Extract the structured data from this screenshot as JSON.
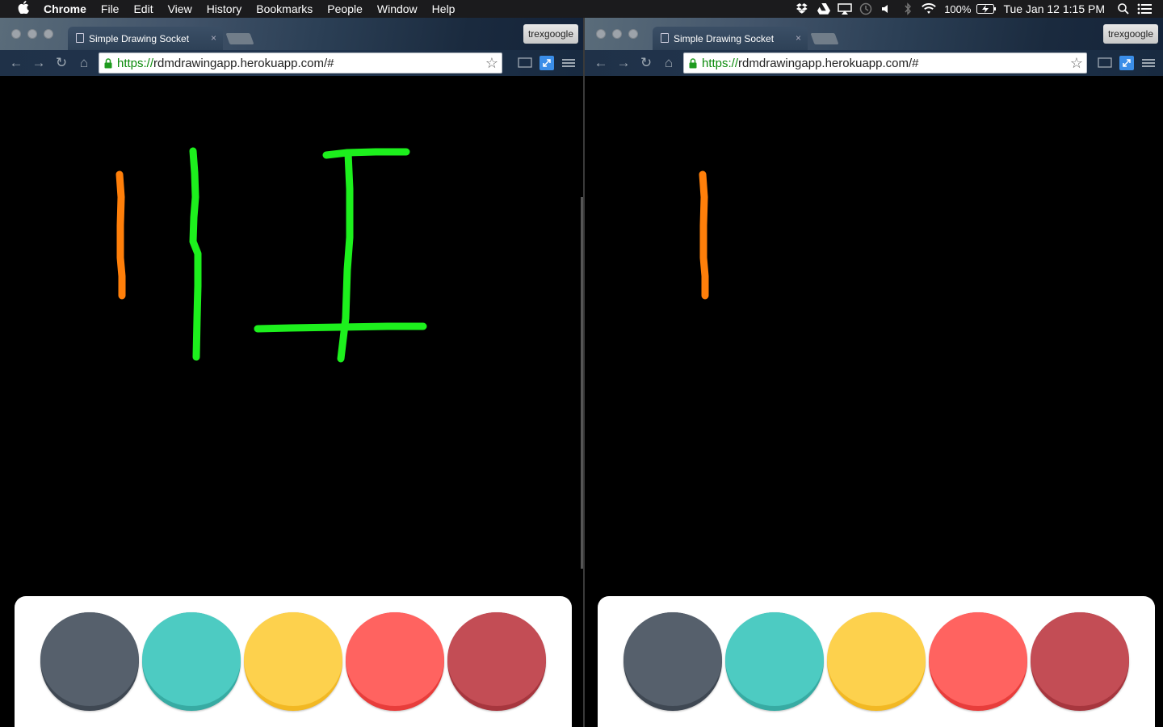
{
  "menubar": {
    "apple_icon": "apple-icon",
    "app_name": "Chrome",
    "menus": [
      "File",
      "Edit",
      "View",
      "History",
      "Bookmarks",
      "People",
      "Window",
      "Help"
    ],
    "battery_text": "100%",
    "clock": "Tue Jan 12  1:15 PM"
  },
  "browser": {
    "tab_title": "Simple Drawing Socket",
    "tab_close": "×",
    "profile": "trexgoogle",
    "url_scheme": "https://",
    "url_rest": "rdmdrawingapp.herokuapp.com/#"
  },
  "palette": {
    "colors": [
      {
        "name": "slate",
        "top": "#56606c",
        "rim": "#3f4853"
      },
      {
        "name": "teal",
        "top": "#4dcbc2",
        "rim": "#37aba3"
      },
      {
        "name": "yellow",
        "top": "#fdd14d",
        "rim": "#f2b823"
      },
      {
        "name": "coral",
        "top": "#ff6360",
        "rim": "#e83d3b"
      },
      {
        "name": "crimson",
        "top": "#c34d55",
        "rim": "#a7363e"
      }
    ]
  },
  "strokes": {
    "orange": "#ff7f0a",
    "green": "#1df01d"
  }
}
